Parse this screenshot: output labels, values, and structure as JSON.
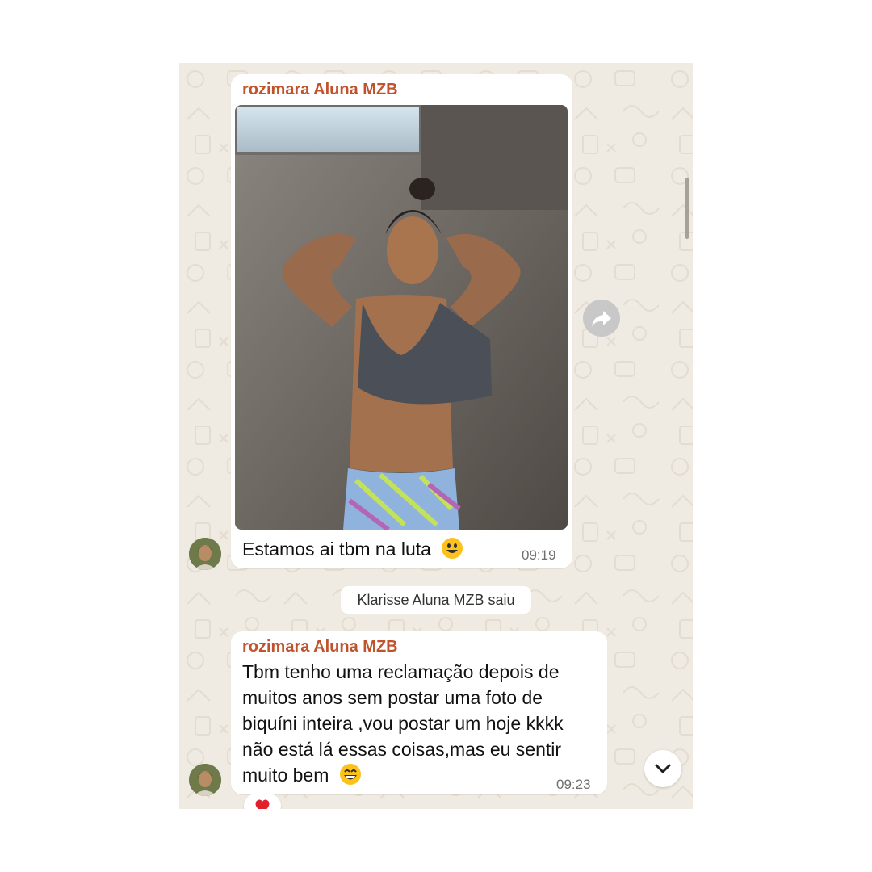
{
  "messages": [
    {
      "sender": "rozimara Aluna MZB",
      "caption": "Estamos ai tbm na luta",
      "caption_emoji": "grinning-face-emoji",
      "time": "09:19",
      "media": "photo"
    },
    {
      "sender": "rozimara Aluna MZB",
      "lines": [
        "Tbm tenho uma reclamação depois de",
        "muitos anos sem postar uma foto de",
        "biquíni inteira ,vou postar um  hoje kkkk",
        "não está lá essas coisas,mas eu sentir",
        "muito bem"
      ],
      "trailing_emoji": "grinning-face-with-smiling-eyes-emoji",
      "time": "09:23",
      "reaction": "red-heart-emoji"
    }
  ],
  "system_message": "Klarisse Aluna MZB saiu",
  "icons": {
    "forward": "forward-arrow-icon",
    "scroll_down": "chevron-down-icon"
  },
  "colors": {
    "chat_background": "#efeae2",
    "sender_name": "#c0532c",
    "bubble": "#ffffff",
    "time": "#6f6f6f"
  }
}
